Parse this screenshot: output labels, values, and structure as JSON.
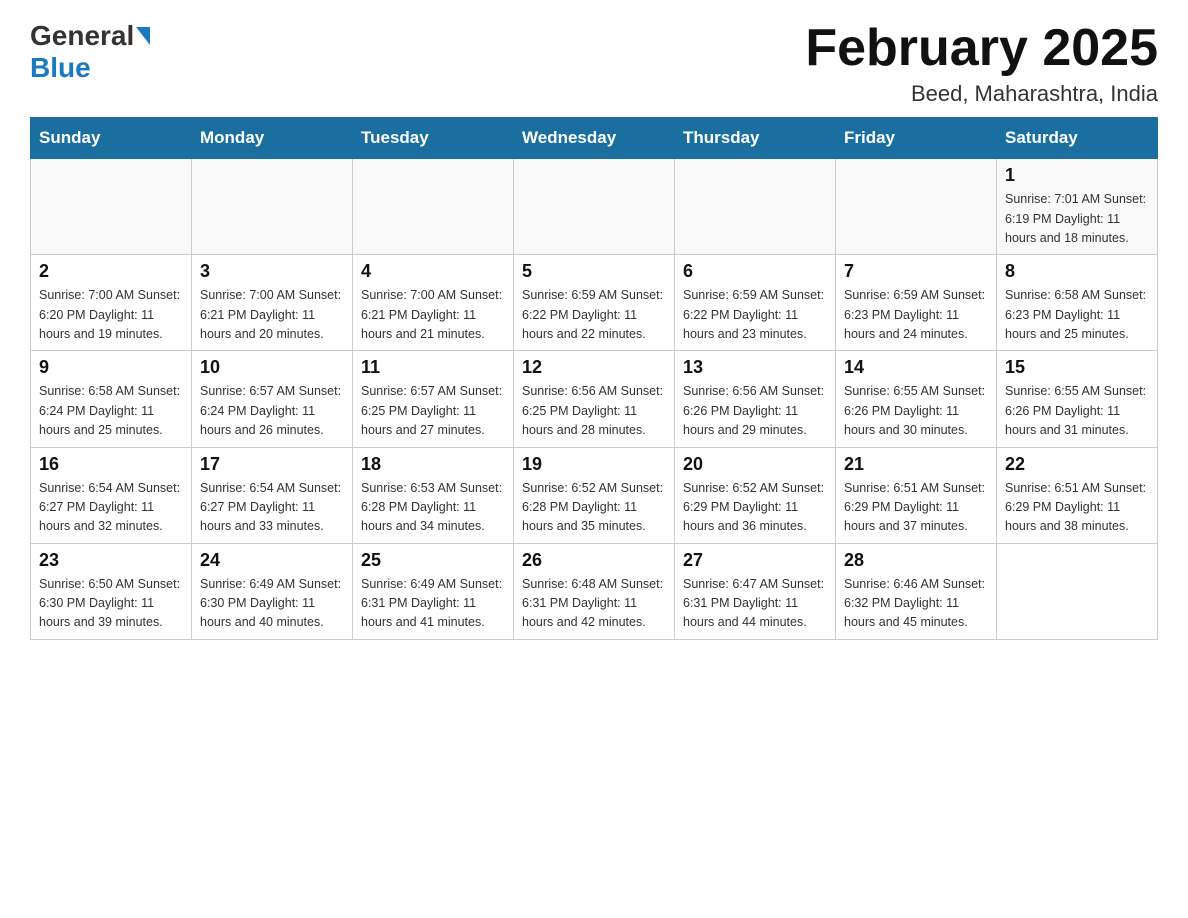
{
  "header": {
    "logo_general": "General",
    "logo_blue": "Blue",
    "month_title": "February 2025",
    "location": "Beed, Maharashtra, India"
  },
  "days_of_week": [
    "Sunday",
    "Monday",
    "Tuesday",
    "Wednesday",
    "Thursday",
    "Friday",
    "Saturday"
  ],
  "weeks": [
    [
      {
        "day": "",
        "info": ""
      },
      {
        "day": "",
        "info": ""
      },
      {
        "day": "",
        "info": ""
      },
      {
        "day": "",
        "info": ""
      },
      {
        "day": "",
        "info": ""
      },
      {
        "day": "",
        "info": ""
      },
      {
        "day": "1",
        "info": "Sunrise: 7:01 AM\nSunset: 6:19 PM\nDaylight: 11 hours and 18 minutes."
      }
    ],
    [
      {
        "day": "2",
        "info": "Sunrise: 7:00 AM\nSunset: 6:20 PM\nDaylight: 11 hours and 19 minutes."
      },
      {
        "day": "3",
        "info": "Sunrise: 7:00 AM\nSunset: 6:21 PM\nDaylight: 11 hours and 20 minutes."
      },
      {
        "day": "4",
        "info": "Sunrise: 7:00 AM\nSunset: 6:21 PM\nDaylight: 11 hours and 21 minutes."
      },
      {
        "day": "5",
        "info": "Sunrise: 6:59 AM\nSunset: 6:22 PM\nDaylight: 11 hours and 22 minutes."
      },
      {
        "day": "6",
        "info": "Sunrise: 6:59 AM\nSunset: 6:22 PM\nDaylight: 11 hours and 23 minutes."
      },
      {
        "day": "7",
        "info": "Sunrise: 6:59 AM\nSunset: 6:23 PM\nDaylight: 11 hours and 24 minutes."
      },
      {
        "day": "8",
        "info": "Sunrise: 6:58 AM\nSunset: 6:23 PM\nDaylight: 11 hours and 25 minutes."
      }
    ],
    [
      {
        "day": "9",
        "info": "Sunrise: 6:58 AM\nSunset: 6:24 PM\nDaylight: 11 hours and 25 minutes."
      },
      {
        "day": "10",
        "info": "Sunrise: 6:57 AM\nSunset: 6:24 PM\nDaylight: 11 hours and 26 minutes."
      },
      {
        "day": "11",
        "info": "Sunrise: 6:57 AM\nSunset: 6:25 PM\nDaylight: 11 hours and 27 minutes."
      },
      {
        "day": "12",
        "info": "Sunrise: 6:56 AM\nSunset: 6:25 PM\nDaylight: 11 hours and 28 minutes."
      },
      {
        "day": "13",
        "info": "Sunrise: 6:56 AM\nSunset: 6:26 PM\nDaylight: 11 hours and 29 minutes."
      },
      {
        "day": "14",
        "info": "Sunrise: 6:55 AM\nSunset: 6:26 PM\nDaylight: 11 hours and 30 minutes."
      },
      {
        "day": "15",
        "info": "Sunrise: 6:55 AM\nSunset: 6:26 PM\nDaylight: 11 hours and 31 minutes."
      }
    ],
    [
      {
        "day": "16",
        "info": "Sunrise: 6:54 AM\nSunset: 6:27 PM\nDaylight: 11 hours and 32 minutes."
      },
      {
        "day": "17",
        "info": "Sunrise: 6:54 AM\nSunset: 6:27 PM\nDaylight: 11 hours and 33 minutes."
      },
      {
        "day": "18",
        "info": "Sunrise: 6:53 AM\nSunset: 6:28 PM\nDaylight: 11 hours and 34 minutes."
      },
      {
        "day": "19",
        "info": "Sunrise: 6:52 AM\nSunset: 6:28 PM\nDaylight: 11 hours and 35 minutes."
      },
      {
        "day": "20",
        "info": "Sunrise: 6:52 AM\nSunset: 6:29 PM\nDaylight: 11 hours and 36 minutes."
      },
      {
        "day": "21",
        "info": "Sunrise: 6:51 AM\nSunset: 6:29 PM\nDaylight: 11 hours and 37 minutes."
      },
      {
        "day": "22",
        "info": "Sunrise: 6:51 AM\nSunset: 6:29 PM\nDaylight: 11 hours and 38 minutes."
      }
    ],
    [
      {
        "day": "23",
        "info": "Sunrise: 6:50 AM\nSunset: 6:30 PM\nDaylight: 11 hours and 39 minutes."
      },
      {
        "day": "24",
        "info": "Sunrise: 6:49 AM\nSunset: 6:30 PM\nDaylight: 11 hours and 40 minutes."
      },
      {
        "day": "25",
        "info": "Sunrise: 6:49 AM\nSunset: 6:31 PM\nDaylight: 11 hours and 41 minutes."
      },
      {
        "day": "26",
        "info": "Sunrise: 6:48 AM\nSunset: 6:31 PM\nDaylight: 11 hours and 42 minutes."
      },
      {
        "day": "27",
        "info": "Sunrise: 6:47 AM\nSunset: 6:31 PM\nDaylight: 11 hours and 44 minutes."
      },
      {
        "day": "28",
        "info": "Sunrise: 6:46 AM\nSunset: 6:32 PM\nDaylight: 11 hours and 45 minutes."
      },
      {
        "day": "",
        "info": ""
      }
    ]
  ]
}
